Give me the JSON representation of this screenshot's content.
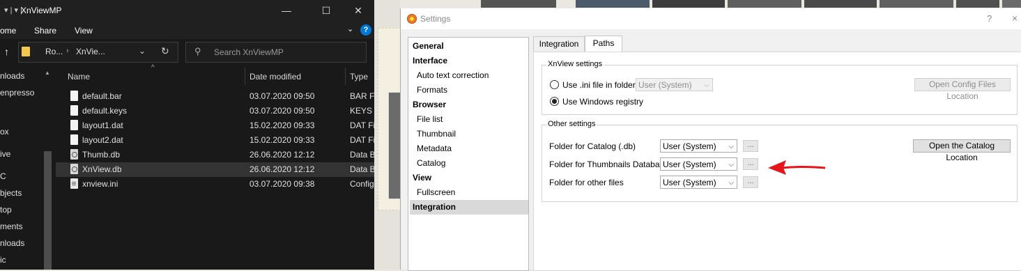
{
  "explorer": {
    "title": "XnViewMP",
    "ribbon": {
      "home": "ome",
      "share": "Share",
      "view": "View"
    },
    "breadcrumb": [
      "Ro...",
      "XnVie..."
    ],
    "search_placeholder": "Search XnViewMP",
    "nav_items": [
      "nloads",
      "enpresso",
      "ox",
      "ive",
      "C",
      "bjects",
      "top",
      "ments",
      "nloads",
      "ic"
    ],
    "columns": {
      "name": "Name",
      "date": "Date modified",
      "type": "Type"
    },
    "files": [
      {
        "name": "default.bar",
        "date": "03.07.2020 09:50",
        "type": "BAR Fi"
      },
      {
        "name": "default.keys",
        "date": "03.07.2020 09:50",
        "type": "KEYS F"
      },
      {
        "name": "layout1.dat",
        "date": "15.02.2020 09:33",
        "type": "DAT Fil"
      },
      {
        "name": "layout2.dat",
        "date": "15.02.2020 09:33",
        "type": "DAT Fil"
      },
      {
        "name": "Thumb.db",
        "date": "26.06.2020 12:12",
        "type": "Data B"
      },
      {
        "name": "XnView.db",
        "date": "26.06.2020 12:12",
        "type": "Data B"
      },
      {
        "name": "xnview.ini",
        "date": "03.07.2020 09:38",
        "type": "Config"
      }
    ],
    "selected_row": 5
  },
  "settings": {
    "title": "Settings",
    "help": "?",
    "close": "×",
    "tree": {
      "general": "General",
      "interface": "Interface",
      "auto_text": "Auto text correction",
      "formats": "Formats",
      "browser": "Browser",
      "file_list": "File list",
      "thumbnail": "Thumbnail",
      "metadata": "Metadata",
      "catalog": "Catalog",
      "view": "View",
      "fullscreen": "Fullscreen",
      "integration": "Integration"
    },
    "tabs": {
      "integration": "Integration",
      "paths": "Paths",
      "active": "Paths"
    },
    "xnview_settings": {
      "title": "XnView settings",
      "ini_option": "Use .ini file in folder",
      "ini_combo": "User (System)",
      "registry_option": "Use Windows registry",
      "selected": "registry",
      "open_config_button": "Open Config Files Location"
    },
    "other_settings": {
      "title": "Other settings",
      "catalog_label": "Folder for Catalog (.db)",
      "catalog_value": "User (System)",
      "thumbs_label": "Folder for Thumbnails Database",
      "thumbs_value": "User (System)",
      "other_label": "Folder for other files",
      "other_value": "User (System)",
      "browse": "...",
      "open_catalog_button": "Open the Catalog Location"
    },
    "annotation_arrow_color": "#e8141b"
  }
}
